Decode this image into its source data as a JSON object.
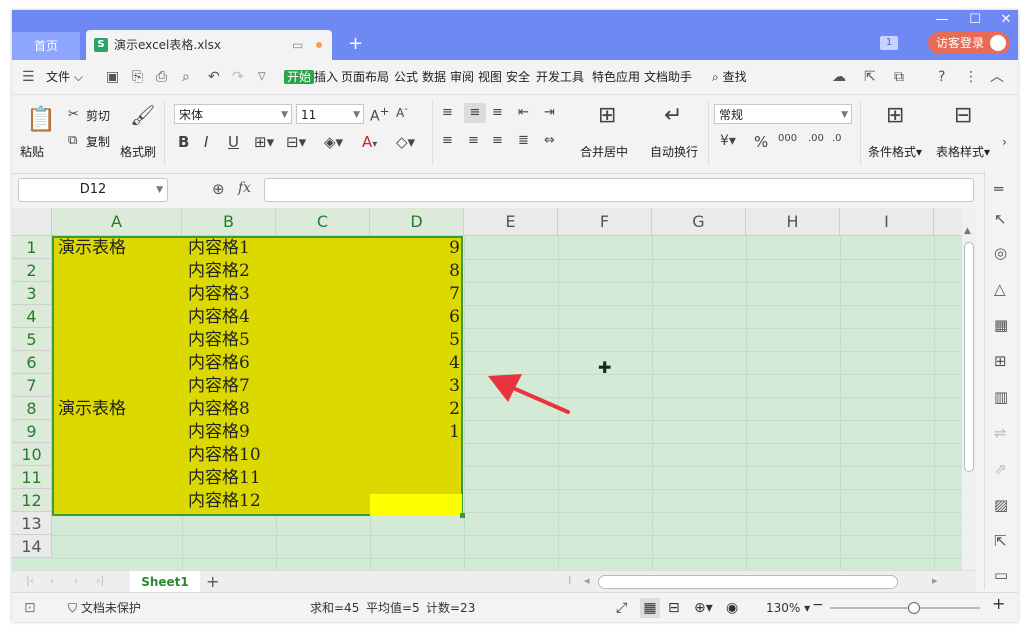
{
  "tabs": {
    "home": "首页",
    "doc_title": "演示excel表格.xlsx",
    "doc_icon": "S"
  },
  "window_badge": "1",
  "login_label": "访客登录",
  "menu": {
    "file": "文件",
    "items": [
      "开始",
      "插入",
      "页面布局",
      "公式",
      "数据",
      "审阅",
      "视图",
      "安全",
      "开发工具",
      "特色应用",
      "文档助手"
    ],
    "search": "查找"
  },
  "ribbon": {
    "paste": "粘贴",
    "cut": "剪切",
    "copy": "复制",
    "format_painter": "格式刷",
    "font_name": "宋体",
    "font_size": "11",
    "merge_center": "合并居中",
    "wrap_text": "自动换行",
    "number_format": "常规",
    "conditional_format": "条件格式",
    "table_style": "表格样式"
  },
  "formula_bar": {
    "name_box": "D12",
    "fx_label": "fx",
    "value": ""
  },
  "columns": [
    "A",
    "B",
    "C",
    "D",
    "E",
    "F",
    "G",
    "H",
    "I"
  ],
  "rows": [
    "1",
    "2",
    "3",
    "4",
    "5",
    "6",
    "7",
    "8",
    "9",
    "10",
    "11",
    "12",
    "13",
    "14"
  ],
  "cells": {
    "a1": "演示表格",
    "a8": "演示表格",
    "b": [
      "内容格1",
      "内容格2",
      "内容格3",
      "内容格4",
      "内容格5",
      "内容格6",
      "内容格7",
      "内容格8",
      "内容格9",
      "内容格10",
      "内容格11",
      "内容格12"
    ],
    "d": [
      "9",
      "8",
      "7",
      "6",
      "5",
      "4",
      "3",
      "2",
      "1"
    ]
  },
  "sheet_tab": "Sheet1",
  "status": {
    "protect": "文档未保护",
    "sum": "求和=45",
    "avg": "平均值=5",
    "count": "计数=23",
    "zoom": "130%"
  },
  "colors": {
    "selection_fill": "#dcd900",
    "selection_border": "#3a9a3a",
    "highlight_cell": "#ffff00",
    "grid_bg": "#d2ead6",
    "titlebar": "#6e88f4",
    "arrow": "#e8343c"
  }
}
